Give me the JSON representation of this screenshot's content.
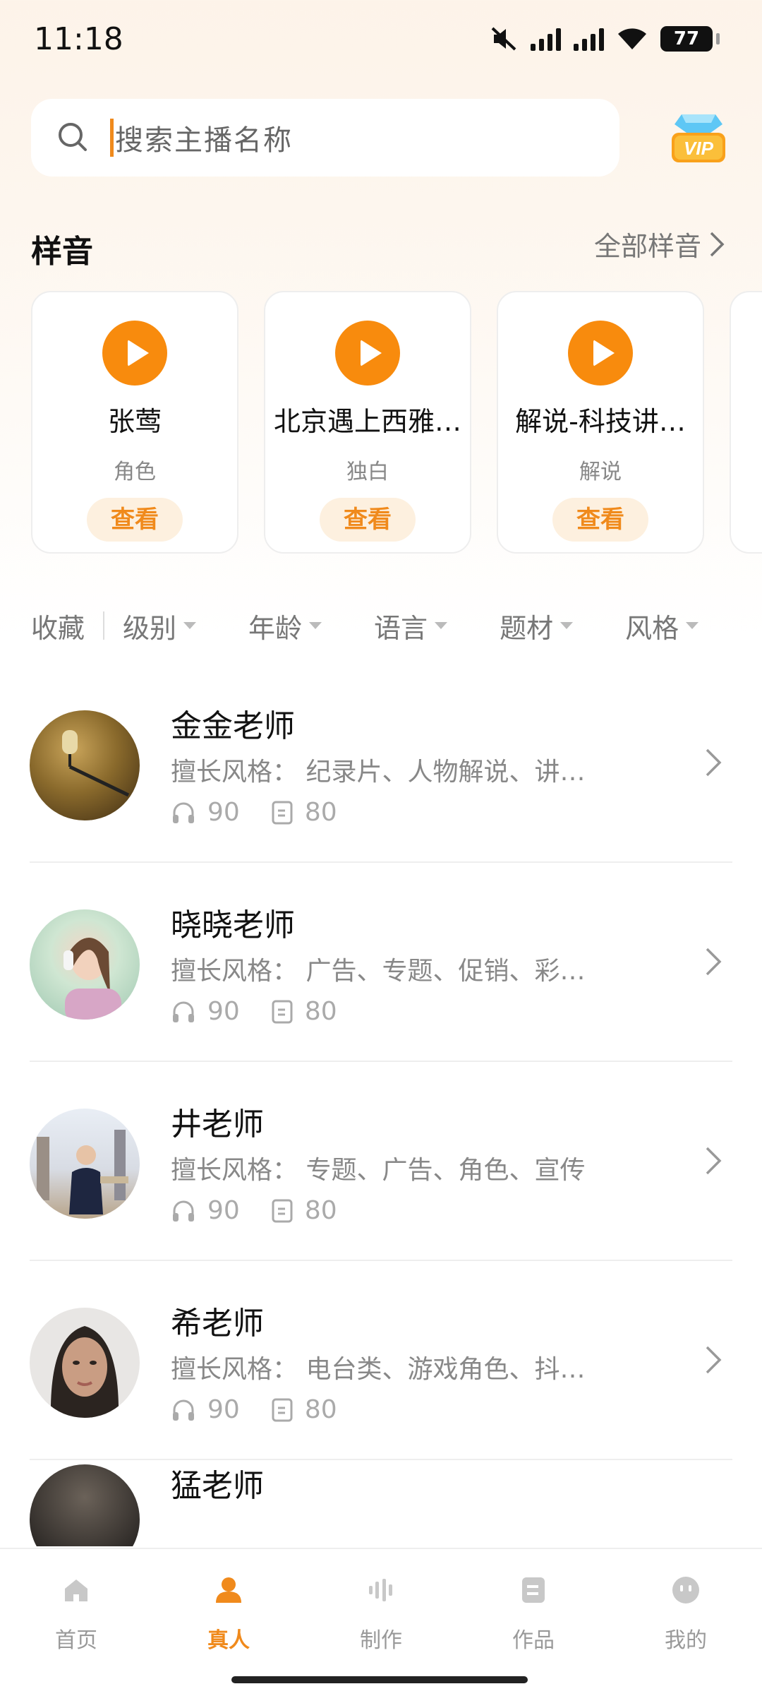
{
  "status_bar": {
    "time": "11:18",
    "battery": "77"
  },
  "search": {
    "placeholder": "搜索主播名称"
  },
  "samples": {
    "title": "样音",
    "more_label": "全部样音",
    "cards": [
      {
        "name": "张莺",
        "category": "角色",
        "button": "查看"
      },
      {
        "name": "北京遇上西雅…",
        "category": "独白",
        "button": "查看"
      },
      {
        "name": "解说-科技讲…",
        "category": "解说",
        "button": "查看"
      }
    ]
  },
  "filters": {
    "favorite": "收藏",
    "items": [
      "级别",
      "年龄",
      "语言",
      "题材",
      "风格"
    ]
  },
  "anchors": [
    {
      "name": "金金老师",
      "style_label": "擅长风格：",
      "style": "纪录片、人物解说、讲…",
      "listens": "90",
      "works": "80"
    },
    {
      "name": "晓晓老师",
      "style_label": "擅长风格：",
      "style": "广告、专题、促销、彩…",
      "listens": "90",
      "works": "80"
    },
    {
      "name": "井老师",
      "style_label": "擅长风格：",
      "style": "专题、广告、角色、宣传",
      "listens": "90",
      "works": "80"
    },
    {
      "name": "希老师",
      "style_label": "擅长风格：",
      "style": "电台类、游戏角色、抖…",
      "listens": "90",
      "works": "80"
    },
    {
      "name": "猛老师",
      "style_label": "",
      "style": "",
      "listens": "",
      "works": ""
    }
  ],
  "tabbar": [
    {
      "label": "首页",
      "icon": "home-icon",
      "active": false
    },
    {
      "label": "真人",
      "icon": "person-icon",
      "active": true
    },
    {
      "label": "制作",
      "icon": "waveform-icon",
      "active": false
    },
    {
      "label": "作品",
      "icon": "document-icon",
      "active": false
    },
    {
      "label": "我的",
      "icon": "face-icon",
      "active": false
    }
  ],
  "colors": {
    "accent": "#f08a1c",
    "play": "#f88b0d",
    "button_bg": "#fdf0df"
  }
}
